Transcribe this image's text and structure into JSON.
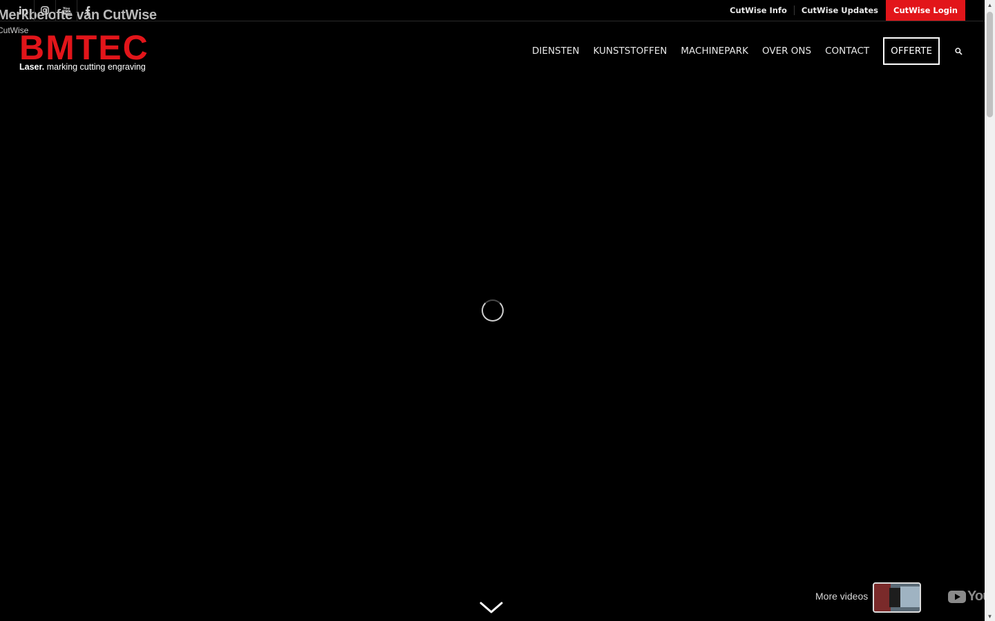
{
  "topbar": {
    "socials": [
      {
        "icon": "linkedin-icon",
        "glyph": "in"
      },
      {
        "icon": "instagram-icon",
        "glyph": ""
      },
      {
        "icon": "youtube-icon",
        "glyph": "You"
      },
      {
        "icon": "facebook-icon",
        "glyph": "f"
      }
    ],
    "links": [
      "CutWise Info",
      "CutWise Updates"
    ],
    "login_label": "CutWise Login"
  },
  "video": {
    "title": "Merkbelofte van CutWise",
    "channel": "CutWise",
    "more_videos": "More videos",
    "youtube_word": "You"
  },
  "logo": {
    "word": "BMTEC",
    "tag_bold": "Laser.",
    "tag_rest": " marking cutting engraving"
  },
  "nav": {
    "items": [
      "DIENSTEN",
      "KUNSTSTOFFEN",
      "MACHINEPARK",
      "OVER ONS",
      "CONTACT"
    ],
    "cta": "OFFERTE"
  },
  "colors": {
    "brand_red": "#e2151a",
    "background": "#000000"
  }
}
